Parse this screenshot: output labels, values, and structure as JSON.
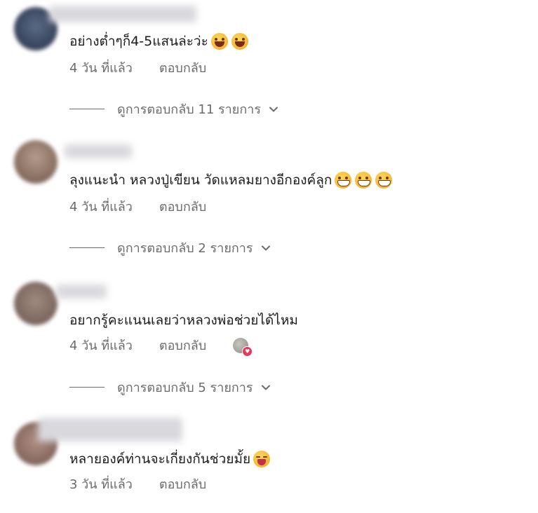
{
  "comments": [
    {
      "text": "อย่างต่ำๆก็4-5แสนล่ะว่ะ",
      "emojis": [
        "laugh",
        "laugh"
      ],
      "time": "4 วัน ที่แล้ว",
      "reply": "ตอบกลับ",
      "view_replies": "ดูการตอบกลับ 11 รายการ"
    },
    {
      "text": "ลุงแนะนำ หลวงปู่เขียน วัดแหลมยางอีกองค์ลูก",
      "emojis": [
        "grin",
        "grin",
        "grin"
      ],
      "time": "4 วัน ที่แล้ว",
      "reply": "ตอบกลับ",
      "view_replies": "ดูการตอบกลับ 2 รายการ"
    },
    {
      "text": "อยากรู้คะแนนเลยว่าหลวงพ่อช่วยได้ไหม",
      "emojis": [],
      "time": "4 วัน ที่แล้ว",
      "reply": "ตอบกลับ",
      "view_replies": "ดูการตอบกลับ 5 รายการ",
      "reaction": "heart-icon"
    },
    {
      "text": "หลายองค์ท่านจะเกี่ยงกันช่วยมั้ย",
      "emojis": [
        "squint"
      ],
      "time": "3 วัน ที่แล้ว",
      "reply": "ตอบกลับ"
    }
  ],
  "colors": {
    "text": "#1b1b1b",
    "meta": "#6b6b6b",
    "heart": "#e8385a",
    "emoji": "#f7b531"
  }
}
